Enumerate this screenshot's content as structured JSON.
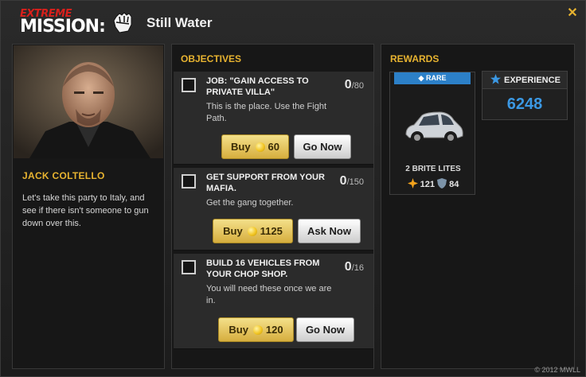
{
  "header": {
    "brand_top": "EXTREME",
    "brand_bottom": "MISSION:",
    "icon": "fist-icon",
    "mission_name": "Still Water",
    "close_label": "✕"
  },
  "character": {
    "name": "JACK COLTELLO",
    "description": "Let's take this party to Italy, and see if there isn't someone to gun down over this."
  },
  "objectives": {
    "title": "OBJECTIVES",
    "items": [
      {
        "title": "JOB: \"GAIN ACCESS TO PRIVATE VILLA\"",
        "current": "0",
        "total": "/80",
        "description": "This is the place. Use the Fight Path.",
        "buy_label": "Buy",
        "buy_cost": "60",
        "action_label": "Go Now"
      },
      {
        "title": "GET SUPPORT FROM YOUR MAFIA.",
        "current": "0",
        "total": "/150",
        "description": "Get the gang together.",
        "buy_label": "Buy",
        "buy_cost": "1125",
        "action_label": "Ask Now"
      },
      {
        "title": "BUILD 16 VEHICLES FROM YOUR CHOP SHOP.",
        "current": "0",
        "total": "/16",
        "description": "You will need these once we are in.",
        "buy_label": "Buy",
        "buy_cost": "120",
        "action_label": "Go Now"
      }
    ]
  },
  "rewards": {
    "title": "REWARDS",
    "loot": {
      "rarity": "◆ RARE",
      "name": "2 BRITE LITES",
      "attack": "121",
      "defense": "84"
    },
    "experience": {
      "label": "EXPERIENCE",
      "value": "6248"
    }
  },
  "footer": {
    "copyright": "© 2012 MWLL"
  },
  "colors": {
    "accent": "#e7b330",
    "rare": "#2c80c8",
    "experience": "#3b98e3"
  }
}
